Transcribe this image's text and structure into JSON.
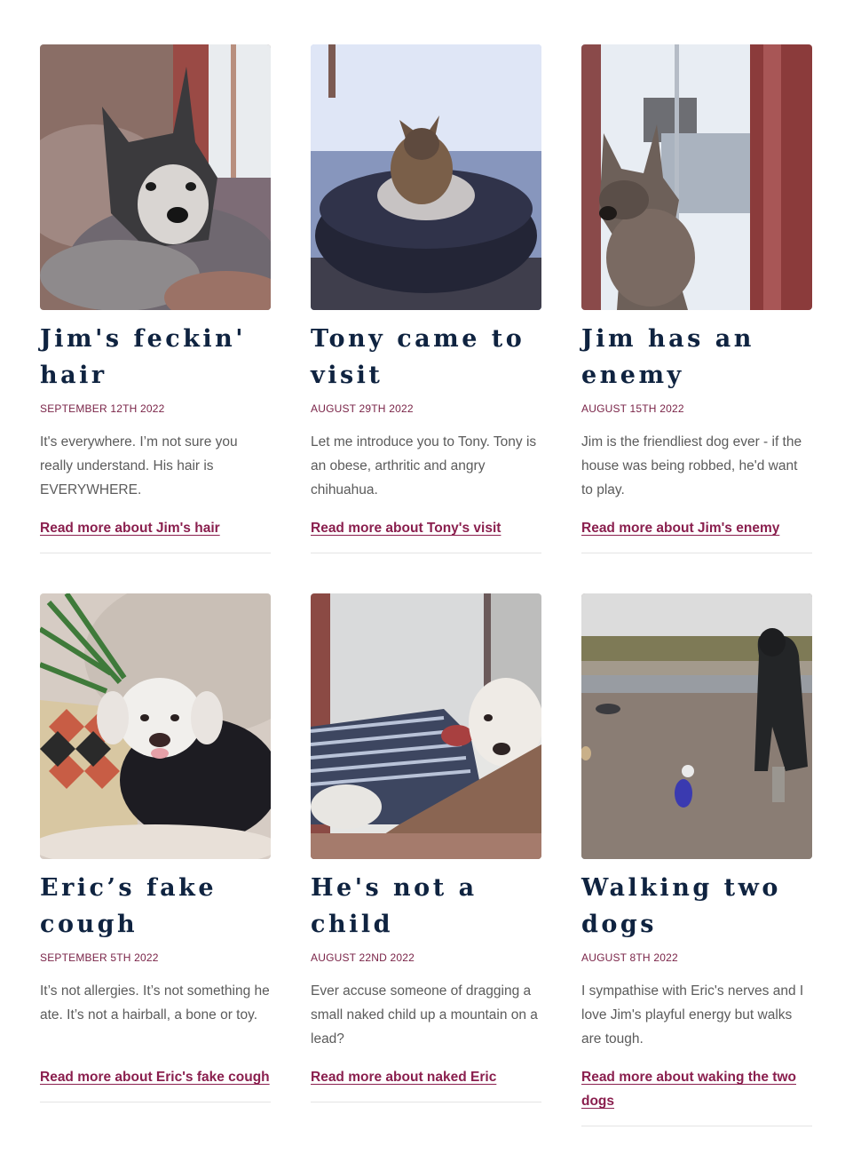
{
  "posts": [
    {
      "title": "Jim's feckin' hair",
      "date": "September 12th 2022",
      "excerpt": "It's everywhere. I’m not sure you really understand. His hair is EVERYWHERE.",
      "link": "Read more about Jim's hair"
    },
    {
      "title": "Tony came to visit",
      "date": "August 29th 2022",
      "excerpt": "Let me introduce you to Tony. Tony is an obese, arthritic and angry chihuahua.",
      "link": "Read more about Tony's visit"
    },
    {
      "title": "Jim has an enemy",
      "date": "August 15th 2022",
      "excerpt": "Jim is the friendliest dog ever - if the house was being robbed, he'd want to play.",
      "link": "Read more about Jim's enemy"
    },
    {
      "title": "Eric’s fake cough",
      "date": "September 5th 2022",
      "excerpt": "It’s not allergies. It’s not something he ate. It’s not a hairball, a bone or toy.",
      "link": "Read more about Eric's fake cough"
    },
    {
      "title": "He's not a child",
      "date": "August 22nd 2022",
      "excerpt": "Ever accuse someone of dragging a small naked child up a mountain on a lead?",
      "link": "Read more about naked Eric"
    },
    {
      "title": "Walking two dogs",
      "date": "August 8th 2022",
      "excerpt": "I sympathise with Eric's nerves and I love Jim's playful energy but walks are tough.",
      "link": "Read more about waking the two dogs"
    }
  ]
}
